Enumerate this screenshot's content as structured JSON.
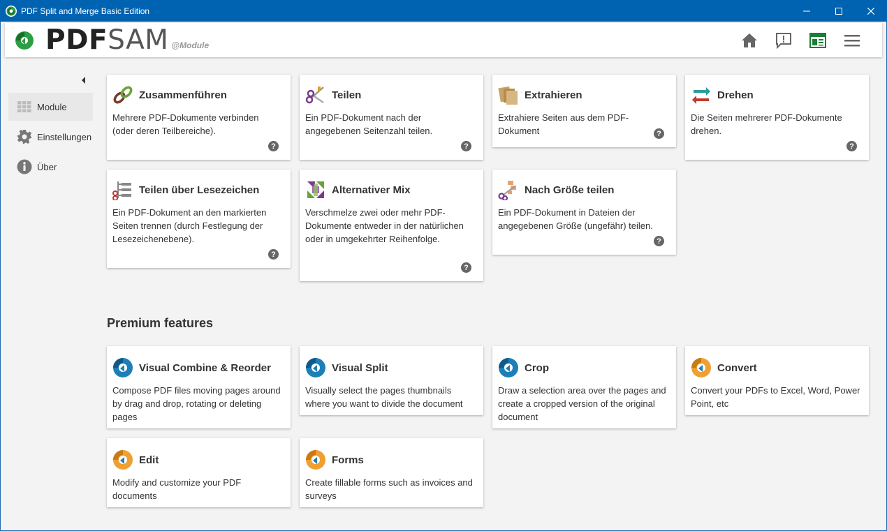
{
  "window": {
    "title": "PDF Split and Merge Basic Edition"
  },
  "header": {
    "logo_pdf": "PDF",
    "logo_sam": "SAM",
    "logo_sub": "@Module"
  },
  "sidebar": {
    "items": [
      {
        "label": "Module",
        "icon": "grid-icon",
        "active": true
      },
      {
        "label": "Einstellungen",
        "icon": "gear-icon",
        "active": false
      },
      {
        "label": "Über",
        "icon": "info-icon",
        "active": false
      }
    ]
  },
  "modules": [
    {
      "title": "Zusammenführen",
      "desc": "Mehrere PDF-Dokumente verbinden (oder deren Teilbereiche).",
      "icon": "chain-link-icon",
      "help": "?"
    },
    {
      "title": "Teilen",
      "desc": "Ein PDF-Dokument nach der angegebenen Seitenzahl teilen.",
      "icon": "scissors-icon",
      "help": "?"
    },
    {
      "title": "Extrahieren",
      "desc": "Extrahiere Seiten aus dem PDF-Dokument",
      "icon": "pages-stack-icon",
      "help": "?"
    },
    {
      "title": "Drehen",
      "desc": "Die Seiten mehrerer PDF-Dokumente drehen.",
      "icon": "rotate-arrows-icon",
      "help": "?"
    },
    {
      "title": "Teilen über Lesezeichen",
      "desc": "Ein PDF-Dokument an den markierten Seiten trennen (durch Festlegung der Lesezeichenebene).",
      "icon": "bookmark-tree-icon",
      "help": "?"
    },
    {
      "title": "Alternativer Mix",
      "desc": "Verschmelze zwei oder mehr PDF-Dokumente entweder in der natürlichen oder in umgekehrter Reihenfolge.",
      "icon": "mix-icon",
      "help": "?"
    },
    {
      "title": "Nach Größe teilen",
      "desc": "Ein PDF-Dokument in Dateien der angegebenen Größe (ungefähr) teilen.",
      "icon": "size-split-icon",
      "help": "?"
    }
  ],
  "premium": {
    "title": "Premium features",
    "items": [
      {
        "title": "Visual Combine & Reorder",
        "desc": "Compose PDF files moving pages around by drag and drop, rotating or deleting pages",
        "icon": "pdfsam-blue-icon"
      },
      {
        "title": "Visual Split",
        "desc": "Visually select the pages thumbnails where you want to divide the document",
        "icon": "pdfsam-blue-icon"
      },
      {
        "title": "Crop",
        "desc": "Draw a selection area over the pages and create a cropped version of the original document",
        "icon": "pdfsam-blue-icon"
      },
      {
        "title": "Convert",
        "desc": "Convert your PDFs to Excel, Word, Power Point, etc",
        "icon": "pdfsam-orange-icon"
      },
      {
        "title": "Edit",
        "desc": "Modify and customize your PDF documents",
        "icon": "pdfsam-orange-icon"
      },
      {
        "title": "Forms",
        "desc": "Create fillable forms such as invoices and surveys",
        "icon": "pdfsam-orange-icon"
      }
    ]
  },
  "colors": {
    "titlebar": "#0063b1",
    "accent_green": "#1a7f37",
    "premium_blue": "#1e7fb8",
    "premium_orange": "#f0a030"
  }
}
